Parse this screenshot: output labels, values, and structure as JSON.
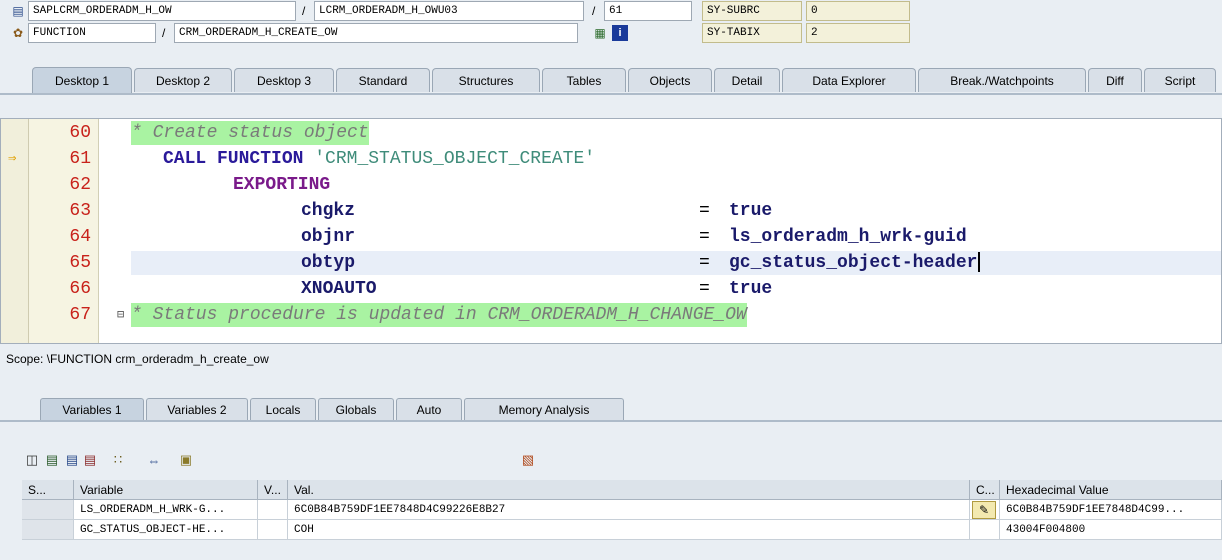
{
  "header": {
    "row1": {
      "program": "SAPLCRM_ORDERADM_H_OW",
      "include": "LCRM_ORDERADM_H_OWU03",
      "line": "61",
      "sys_label": "SY-SUBRC",
      "sys_value": "0"
    },
    "row2": {
      "kind": "FUNCTION",
      "name": "CRM_ORDERADM_H_CREATE_OW",
      "sys_label": "SY-TABIX",
      "sys_value": "2"
    },
    "separator": "/"
  },
  "tabs": [
    "Desktop 1",
    "Desktop 2",
    "Desktop 3",
    "Standard",
    "Structures",
    "Tables",
    "Objects",
    "Detail",
    "Data Explorer",
    "Break./Watchpoints",
    "Diff",
    "Script"
  ],
  "editor": {
    "current_line": "61",
    "lines": [
      {
        "no": "60",
        "t1": "* Create status object"
      },
      {
        "no": "61",
        "t1": "CALL FUNCTION ",
        "t2": "'CRM_STATUS_OBJECT_CREATE'"
      },
      {
        "no": "62",
        "t1": "EXPORTING"
      },
      {
        "no": "63",
        "t1": "chgkz",
        "t2": "=",
        "t3": "true"
      },
      {
        "no": "64",
        "t1": "objnr",
        "t2": "=",
        "t3": "ls_orderadm_h_wrk-guid"
      },
      {
        "no": "65",
        "t1": "obtyp",
        "t2": "=",
        "t3": "gc_status_object-header"
      },
      {
        "no": "66",
        "t1": "XNOAUTO",
        "t2": "=",
        "t3": "true"
      },
      {
        "no": "67",
        "t1": "* Status procedure is updated in CRM_ORDERADM_H_CHANGE_OW"
      }
    ]
  },
  "scope": "Scope: \\FUNCTION crm_orderadm_h_create_ow",
  "lower_tabs": [
    "Variables 1",
    "Variables 2",
    "Locals",
    "Globals",
    "Auto",
    "Memory Analysis"
  ],
  "toolbar": [
    "delete-icon",
    "variables-icon",
    "variables-icon",
    "variables-icon",
    "hierarchy-icon",
    "transfer-icon",
    "folder-icon",
    "save-icon"
  ],
  "table": {
    "columns": [
      "S...",
      "Variable",
      "V...",
      "Val.",
      "C...",
      "Hexadecimal Value"
    ],
    "rows": [
      {
        "variable": "LS_ORDERADM_H_WRK-G...",
        "value": "6C0B84B759DF1EE7848D4C99226E8B27",
        "hex": "6C0B84B759DF1EE7848D4C99..."
      },
      {
        "variable": "GC_STATUS_OBJECT-HE...",
        "value": "COH",
        "hex": "43004F004800"
      }
    ]
  }
}
